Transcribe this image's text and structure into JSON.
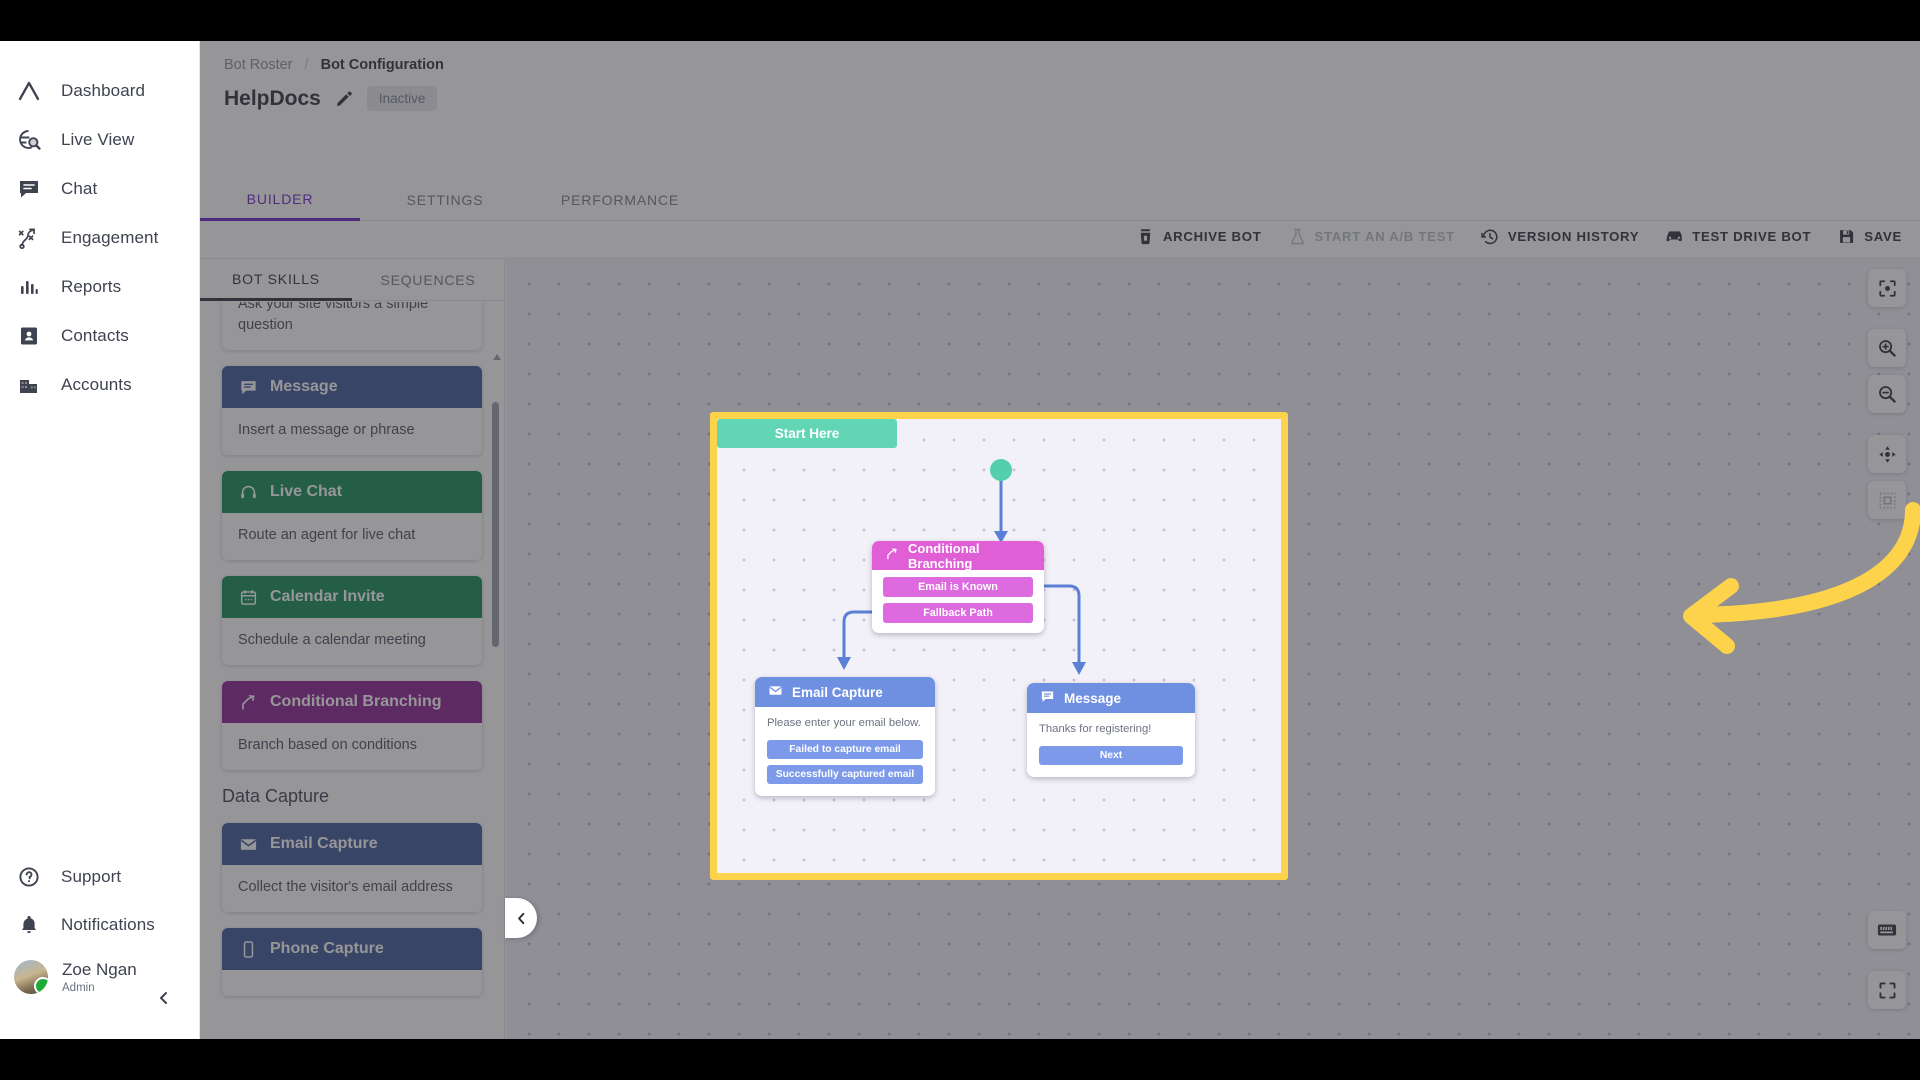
{
  "sidebar": {
    "items": [
      {
        "label": "Dashboard",
        "icon": "logo-caret-icon"
      },
      {
        "label": "Live View",
        "icon": "globe-search-icon"
      },
      {
        "label": "Chat",
        "icon": "chat-bubble-icon"
      },
      {
        "label": "Engagement",
        "icon": "strategy-icon"
      },
      {
        "label": "Reports",
        "icon": "bar-chart-icon"
      },
      {
        "label": "Contacts",
        "icon": "contact-card-icon"
      },
      {
        "label": "Accounts",
        "icon": "building-icon"
      }
    ],
    "bottom": [
      {
        "label": "Support",
        "icon": "question-circle-icon"
      },
      {
        "label": "Notifications",
        "icon": "bell-icon"
      }
    ],
    "user": {
      "name": "Zoe Ngan",
      "role": "Admin",
      "status": "online"
    },
    "collapse_icon": "chevron-left-icon"
  },
  "breadcrumb": {
    "parent": "Bot Roster",
    "separator": "/",
    "current": "Bot Configuration"
  },
  "header": {
    "bot_name": "HelpDocs",
    "edit_icon": "pencil-icon",
    "status_badge": "Inactive"
  },
  "tabs": [
    {
      "label": "BUILDER",
      "active": true
    },
    {
      "label": "SETTINGS",
      "active": false
    },
    {
      "label": "PERFORMANCE",
      "active": false
    }
  ],
  "toolbar": [
    {
      "label": "ARCHIVE BOT",
      "icon": "trash-icon",
      "disabled": false
    },
    {
      "label": "START AN A/B TEST",
      "icon": "flask-icon",
      "disabled": true
    },
    {
      "label": "VERSION HISTORY",
      "icon": "history-clock-icon",
      "disabled": false
    },
    {
      "label": "TEST DRIVE BOT",
      "icon": "car-icon",
      "disabled": false
    },
    {
      "label": "SAVE",
      "icon": "floppy-disk-icon",
      "disabled": false
    }
  ],
  "panel": {
    "tabs": [
      {
        "label": "BOT SKILLS",
        "active": true
      },
      {
        "label": "SEQUENCES",
        "active": false
      }
    ],
    "cards": [
      {
        "title": "",
        "desc": "Ask your site visitors a simple question",
        "color": "#3b5697",
        "icon": "",
        "partial": true
      },
      {
        "title": "Message",
        "desc": "Insert a message or phrase",
        "color": "#3b5697",
        "icon": "chat-bubble-icon"
      },
      {
        "title": "Live Chat",
        "desc": "Route an agent for live chat",
        "color": "#118b54",
        "icon": "headset-icon"
      },
      {
        "title": "Calendar Invite",
        "desc": "Schedule a calendar meeting",
        "color": "#118b54",
        "icon": "calendar-icon"
      },
      {
        "title": "Conditional Branching",
        "desc": "Branch based on conditions",
        "color": "#8b1f8f",
        "icon": "branch-icon"
      }
    ],
    "section_title": "Data Capture",
    "capture_cards": [
      {
        "title": "Email Capture",
        "desc": "Collect the visitor's email address",
        "color": "#3b5697",
        "icon": "envelope-icon"
      },
      {
        "title": "Phone Capture",
        "desc": "",
        "color": "#3b5697",
        "icon": "phone-icon",
        "partial": true
      }
    ],
    "collapse_icon": "chevron-left-icon"
  },
  "canvas": {
    "zoom_tools": [
      {
        "name": "fit-to-screen",
        "icon": "focus-frame-icon"
      },
      {
        "name": "zoom-in",
        "icon": "magnifier-plus-icon"
      },
      {
        "name": "zoom-out",
        "icon": "magnifier-minus-icon"
      },
      {
        "name": "pan",
        "icon": "move-arrows-icon"
      },
      {
        "name": "snap-to-grid",
        "icon": "dashed-square-icon"
      }
    ],
    "bottom_tools": [
      {
        "name": "keyboard-shortcuts",
        "icon": "keyboard-icon"
      },
      {
        "name": "fullscreen",
        "icon": "expand-corners-icon"
      }
    ],
    "highlight_color": "#fcd34a",
    "annotation": {
      "type": "curved-arrow",
      "direction": "left",
      "color": "#fcd34a"
    }
  },
  "flow": {
    "start": {
      "label": "Start Here",
      "color": "#62d6b4"
    },
    "conditional": {
      "title": "Conditional Branching",
      "icon": "branch-icon",
      "color": "#e05ed6",
      "options": [
        "Email is Known",
        "Fallback Path"
      ]
    },
    "email_capture": {
      "title": "Email Capture",
      "icon": "envelope-icon",
      "color": "#6f8fe0",
      "body": "Please enter your email below.",
      "buttons": [
        "Failed to capture email",
        "Successfully captured email"
      ]
    },
    "message": {
      "title": "Message",
      "icon": "chat-bubble-icon",
      "color": "#6f8fe0",
      "body": "Thanks for registering!",
      "buttons": [
        "Next"
      ]
    }
  }
}
